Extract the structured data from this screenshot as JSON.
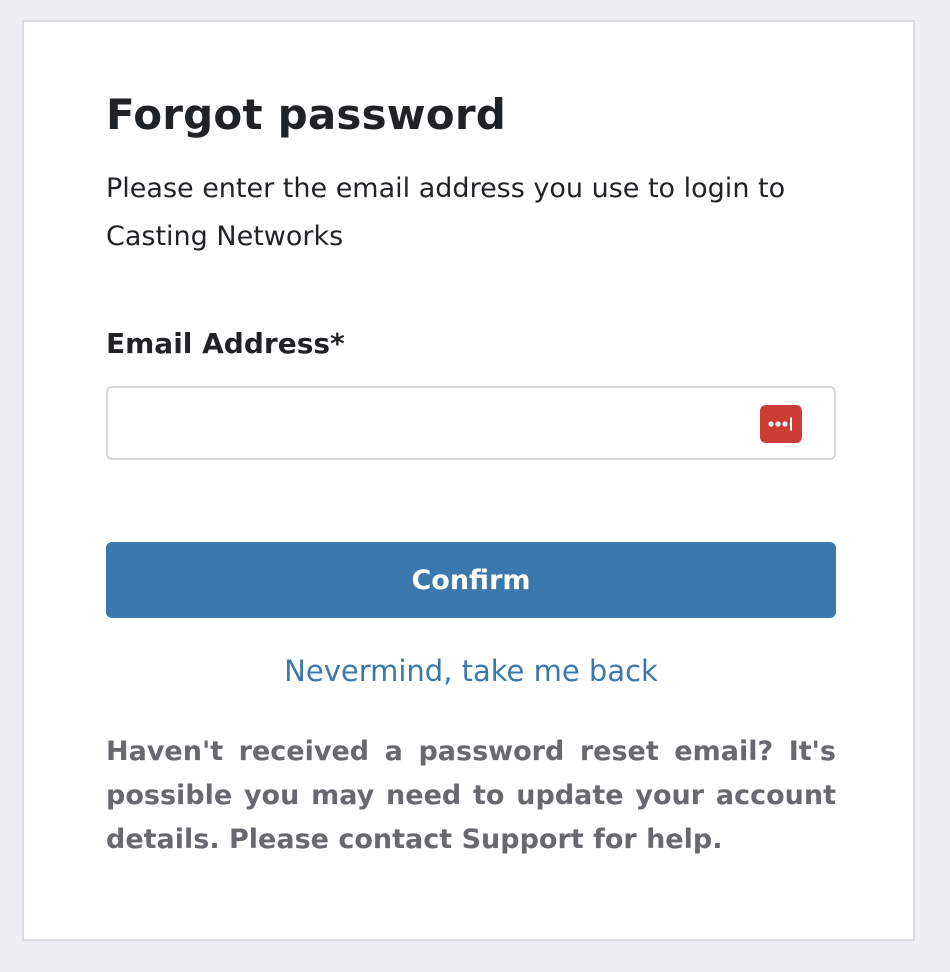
{
  "form": {
    "title": "Forgot password",
    "intro": "Please enter the email address you use to login to Casting Networks",
    "email_label": "Email Address*",
    "email_value": "",
    "email_placeholder": "",
    "confirm_label": "Confirm",
    "back_link": "Nevermind, take me back",
    "help_text": "Haven't received a password reset email? It's possible you may need to update your account details. Please contact Support for help."
  },
  "icons": {
    "password_manager": "lastpass-icon"
  },
  "colors": {
    "accent": "#3b78ad",
    "lastpass_red": "#cc3d34"
  }
}
